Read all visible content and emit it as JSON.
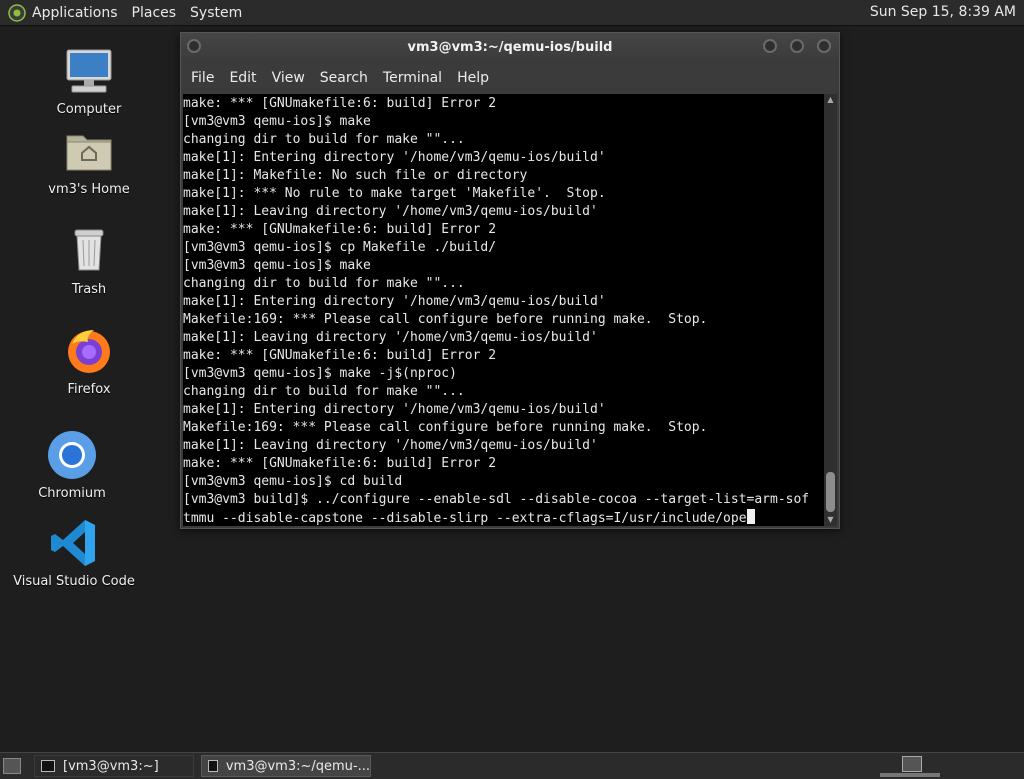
{
  "top_panel": {
    "menus": [
      "Applications",
      "Places",
      "System"
    ],
    "clock": "Sun Sep 15,  8:39 AM"
  },
  "desktop_icons": [
    {
      "label": "Computer",
      "icon": "computer-icon"
    },
    {
      "label": "vm3's Home",
      "icon": "home-folder-icon"
    },
    {
      "label": "Trash",
      "icon": "trash-icon"
    },
    {
      "label": "Firefox",
      "icon": "firefox-icon"
    },
    {
      "label": "Chromium",
      "icon": "chromium-icon"
    },
    {
      "label": "Visual Studio Code",
      "icon": "vscode-icon"
    }
  ],
  "terminal": {
    "title": "vm3@vm3:~/qemu-ios/build",
    "menu": [
      "File",
      "Edit",
      "View",
      "Search",
      "Terminal",
      "Help"
    ],
    "lines": [
      "make: *** [GNUmakefile:6: build] Error 2",
      "[vm3@vm3 qemu-ios]$ make",
      "changing dir to build for make \"\"...",
      "make[1]: Entering directory '/home/vm3/qemu-ios/build'",
      "make[1]: Makefile: No such file or directory",
      "make[1]: *** No rule to make target 'Makefile'.  Stop.",
      "make[1]: Leaving directory '/home/vm3/qemu-ios/build'",
      "make: *** [GNUmakefile:6: build] Error 2",
      "[vm3@vm3 qemu-ios]$ cp Makefile ./build/",
      "[vm3@vm3 qemu-ios]$ make",
      "changing dir to build for make \"\"...",
      "make[1]: Entering directory '/home/vm3/qemu-ios/build'",
      "Makefile:169: *** Please call configure before running make.  Stop.",
      "make[1]: Leaving directory '/home/vm3/qemu-ios/build'",
      "make: *** [GNUmakefile:6: build] Error 2",
      "[vm3@vm3 qemu-ios]$ make -j$(nproc)",
      "changing dir to build for make \"\"...",
      "make[1]: Entering directory '/home/vm3/qemu-ios/build'",
      "Makefile:169: *** Please call configure before running make.  Stop.",
      "make[1]: Leaving directory '/home/vm3/qemu-ios/build'",
      "make: *** [GNUmakefile:6: build] Error 2",
      "[vm3@vm3 qemu-ios]$ cd build",
      "[vm3@vm3 build]$ ../configure --enable-sdl --disable-cocoa --target-list=arm-sof",
      "tmmu --disable-capstone --disable-slirp --extra-cflags=I/usr/include/ope"
    ]
  },
  "taskbar": {
    "tasks": [
      "[vm3@vm3:~]",
      "vm3@vm3:~/qemu-..."
    ]
  },
  "colors": {
    "desktop_bg": "#1e1e1e",
    "panel_bg": "#2b2b2b",
    "terminal_bg": "#000000",
    "terminal_fg": "#e8e8e8"
  }
}
